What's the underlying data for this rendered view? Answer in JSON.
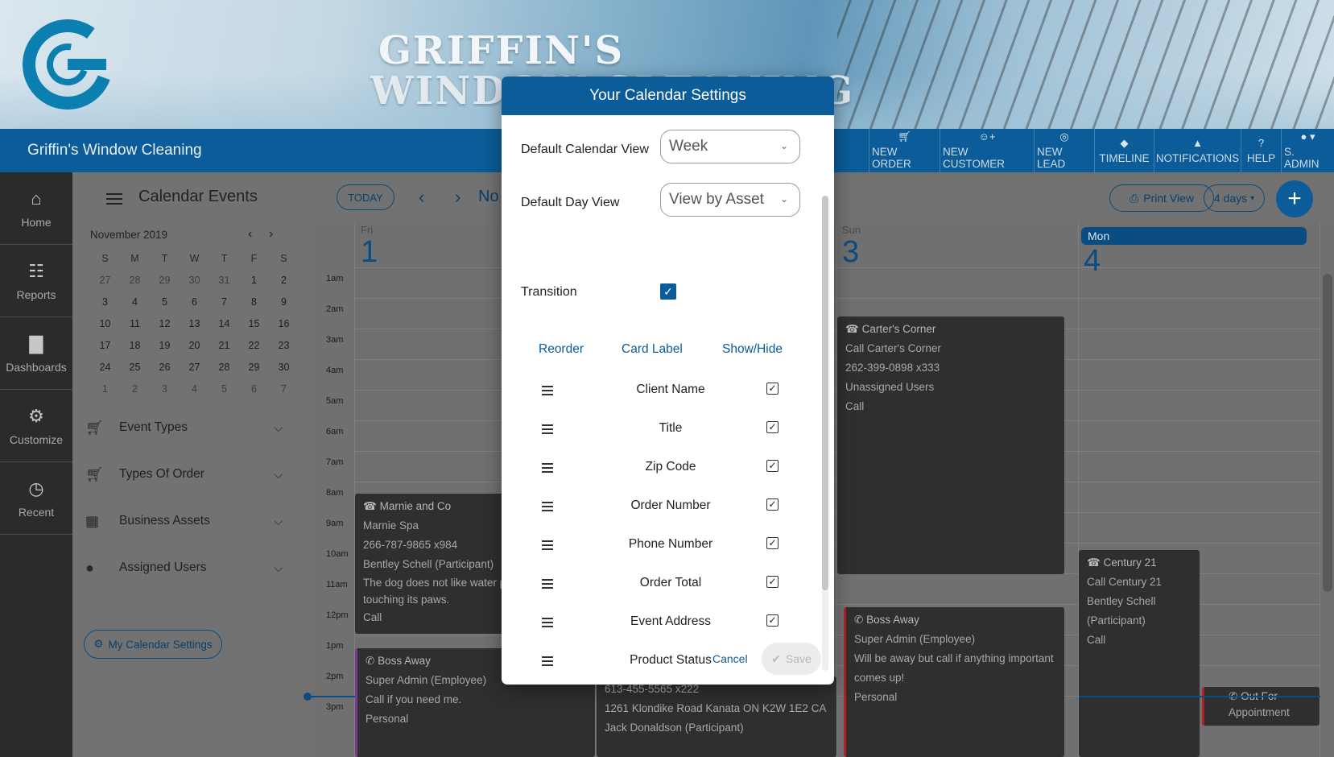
{
  "banner": {
    "brand_line1": "GRIFFIN'S",
    "brand_line2": "WINDOW CLEANING"
  },
  "topbar": {
    "app_title": "Griffin's Window Cleaning",
    "nav": [
      {
        "label": "NEW ORDER",
        "icon": "cart-icon"
      },
      {
        "label": "NEW CUSTOMER",
        "icon": "user-plus-icon"
      },
      {
        "label": "NEW LEAD",
        "icon": "target-icon"
      },
      {
        "label": "TIMELINE",
        "icon": "graduation-cap-icon"
      },
      {
        "label": "NOTIFICATIONS",
        "icon": "bell-icon"
      },
      {
        "label": "HELP",
        "icon": "question-icon"
      },
      {
        "label": "S. ADMIN",
        "icon": "user-icon"
      }
    ]
  },
  "rail": [
    {
      "label": "Home",
      "icon": "home-icon"
    },
    {
      "label": "Reports",
      "icon": "document-icon"
    },
    {
      "label": "Dashboards",
      "icon": "bar-chart-icon"
    },
    {
      "label": "Customize",
      "icon": "gear-icon"
    },
    {
      "label": "Recent",
      "icon": "clock-icon"
    }
  ],
  "header": {
    "page_title": "Calendar Events",
    "today_label": "TODAY",
    "month_label": "No",
    "print_label": "Print View",
    "days_label": "4 days",
    "add_label": "+"
  },
  "mini_calendar": {
    "title": "November 2019",
    "dow": [
      "S",
      "M",
      "T",
      "W",
      "T",
      "F",
      "S"
    ],
    "weeks": [
      [
        "27",
        "28",
        "29",
        "30",
        "31",
        "1",
        "2"
      ],
      [
        "3",
        "4",
        "5",
        "6",
        "7",
        "8",
        "9"
      ],
      [
        "10",
        "11",
        "12",
        "13",
        "14",
        "15",
        "16"
      ],
      [
        "17",
        "18",
        "19",
        "20",
        "21",
        "22",
        "23"
      ],
      [
        "24",
        "25",
        "26",
        "27",
        "28",
        "29",
        "30"
      ],
      [
        "1",
        "2",
        "3",
        "4",
        "5",
        "6",
        "7"
      ]
    ]
  },
  "filters": [
    {
      "label": "Event Types",
      "icon": "cart-icon"
    },
    {
      "label": "Types Of Order",
      "icon": "cart-icon"
    },
    {
      "label": "Business Assets",
      "icon": "truck-icon"
    },
    {
      "label": "Assigned Users",
      "icon": "user-icon"
    }
  ],
  "my_calendar_settings_label": "My Calendar Settings",
  "calendar": {
    "times": [
      "1am",
      "2am",
      "3am",
      "4am",
      "5am",
      "6am",
      "7am",
      "8am",
      "9am",
      "10am",
      "11am",
      "12pm",
      "1pm",
      "2pm",
      "3pm"
    ],
    "days": [
      {
        "name": "Fri",
        "num": "1"
      },
      {
        "name": "Sun",
        "num": "3"
      },
      {
        "name": "Mon",
        "num": "4"
      }
    ],
    "events": [
      {
        "id": "carter",
        "title": "Carter's Corner",
        "lines": [
          "Call Carter's Corner",
          "262-399-0898 x333",
          "Unassigned Users",
          "Call"
        ]
      },
      {
        "id": "marnie",
        "title": "Marnie and Co",
        "lines": [
          "Marnie Spa",
          "266-787-9865 x984",
          "Bentley Schell (Participant)",
          "The dog does not like water people touching its paws.",
          "Call"
        ]
      },
      {
        "id": "boss1",
        "title": "Boss Away",
        "lines": [
          "Super Admin (Employee)",
          "Call if you need me.",
          "Personal"
        ]
      },
      {
        "id": "klondike",
        "title": "",
        "lines": [
          "613-455-5565 x222",
          "1261 Klondike Road Kanata ON K2W 1E2 CA",
          "Jack Donaldson (Participant)"
        ]
      },
      {
        "id": "boss2",
        "title": "Boss Away",
        "lines": [
          "Super Admin (Employee)",
          "Will be away but call if anything important comes up!",
          "Personal"
        ]
      },
      {
        "id": "century",
        "title": "Century 21",
        "lines": [
          "Call Century 21",
          "Bentley Schell (Participant)",
          "Call"
        ]
      },
      {
        "id": "outfor",
        "title": "Out For",
        "lines": [
          "Appointment"
        ]
      }
    ]
  },
  "modal": {
    "title": "Your Calendar Settings",
    "default_view_label": "Default Calendar View",
    "default_view_value": "Week",
    "default_day_label": "Default Day View",
    "default_day_value": "View by Asset",
    "transition_label": "Transition",
    "transition_checked": true,
    "col_reorder": "Reorder",
    "col_card_label": "Card Label",
    "col_show_hide": "Show/Hide",
    "fields": [
      {
        "label": "Client Name",
        "shown": true
      },
      {
        "label": "Title",
        "shown": true
      },
      {
        "label": "Zip Code",
        "shown": true
      },
      {
        "label": "Order Number",
        "shown": true
      },
      {
        "label": "Phone Number",
        "shown": true
      },
      {
        "label": "Order Total",
        "shown": true
      },
      {
        "label": "Event Address",
        "shown": true
      },
      {
        "label": "Product Status",
        "shown": true
      }
    ],
    "cancel_label": "Cancel",
    "save_label": "Save"
  },
  "colors": {
    "primary": "#0b5c98",
    "dark_panel": "#2b2b2b",
    "accent_purple": "#7a3b8f",
    "accent_red": "#b01f2a"
  }
}
